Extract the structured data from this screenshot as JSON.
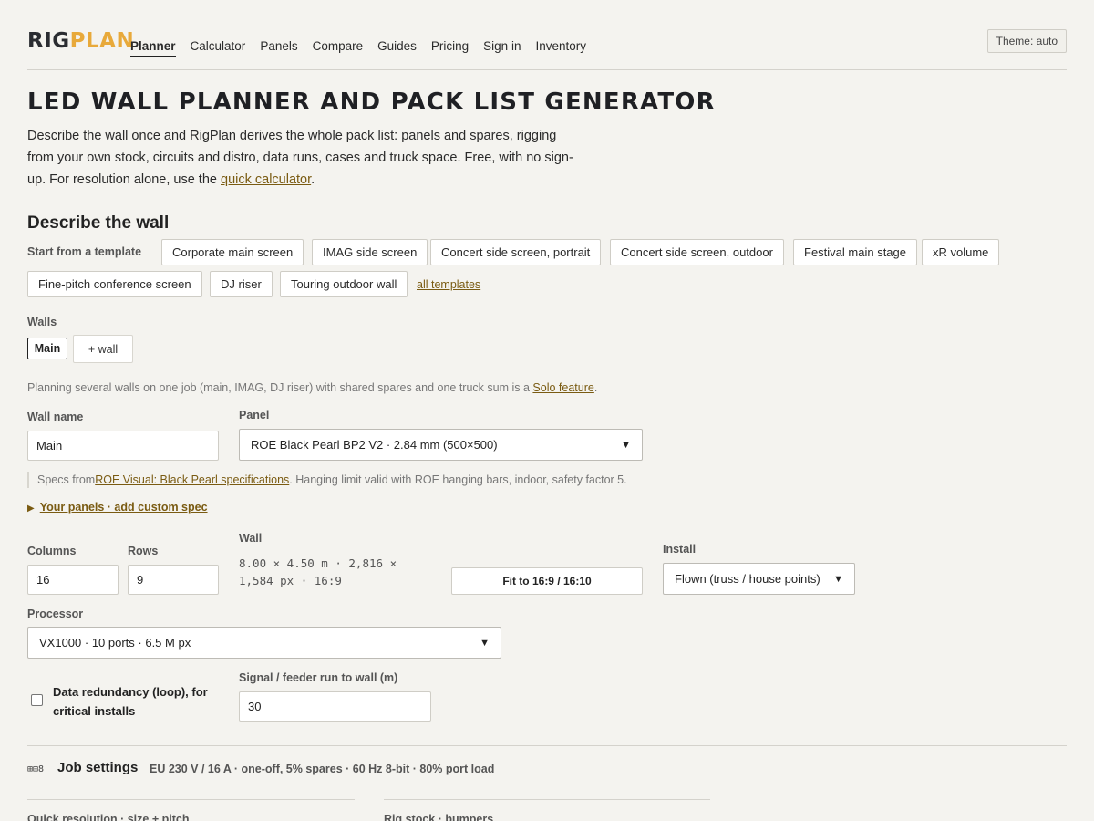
{
  "header": {
    "logo_part1": "RIG",
    "logo_part2": "PLAN",
    "nav": [
      "Planner",
      "Calculator",
      "Panels",
      "Compare",
      "Guides",
      "Pricing",
      "Sign in",
      "Inventory"
    ],
    "active_nav": "Planner",
    "theme_button": "Theme: auto"
  },
  "hero": {
    "title": "LED WALL PLANNER AND PACK LIST GENERATOR",
    "desc_text": "Describe the wall once and RigPlan derives the whole pack list: panels and spares, rigging from your own stock, circuits and distro, data runs, cases and truck space. Free, with no sign-up. For resolution alone, use the ",
    "desc_link": "quick calculator",
    "desc_end": "."
  },
  "describe": {
    "title": "Describe the wall",
    "template_label": "Start from a template",
    "templates": [
      "Corporate main screen",
      "IMAG side screen",
      "Concert side screen, portrait",
      "Concert side screen, outdoor",
      "Festival main stage",
      "xR volume",
      "Fine-pitch conference screen",
      "DJ riser",
      "Touring outdoor wall"
    ],
    "all_templates": "all templates"
  },
  "walls": {
    "label": "Walls",
    "tabs": [
      "Main"
    ],
    "add_label": "+ wall",
    "note_text": "Planning several walls on one job (main, IMAG, DJ riser) with shared spares and one truck sum is a ",
    "note_link": "Solo feature",
    "note_end": "."
  },
  "wall_form": {
    "name_label": "Wall name",
    "name_value": "Main",
    "panel_label": "Panel",
    "panel_value": "ROE Black Pearl BP2 V2 · 2.84 mm (500×500)",
    "spec_prefix": "Specs from ",
    "spec_link": "ROE Visual: Black Pearl specifications",
    "spec_suffix": ". Hanging limit valid with ROE hanging bars, indoor, safety factor 5.",
    "custom_spec": "Your panels · add custom spec",
    "columns_label": "Columns",
    "columns_value": "16",
    "rows_label": "Rows",
    "rows_value": "9",
    "wall_label": "Wall",
    "wall_readout_line1": "8.00 × 4.50 m · 2,816 ×",
    "wall_readout_line2": "1,584 px · 16:9",
    "fit_button": "Fit to 16:9 / 16:10",
    "install_label": "Install",
    "install_value": "Flown (truss / house points)",
    "processor_label": "Processor",
    "processor_value": "VX1000 · 10 ports · 6.5 M px",
    "redundancy_label": "Data redundancy (loop), for critical installs",
    "redundancy_checked": false,
    "signal_label": "Signal / feeder run to wall (m)",
    "signal_value": "30"
  },
  "job": {
    "icon_text": "⊞⊟8",
    "title": "Job settings",
    "summary": "EU 230 V / 16 A · one-off, 5% spares · 60 Hz 8-bit · 80% port load",
    "sub1": "Quick resolution · size + pitch",
    "sub2": "Rig stock · bumpers"
  }
}
